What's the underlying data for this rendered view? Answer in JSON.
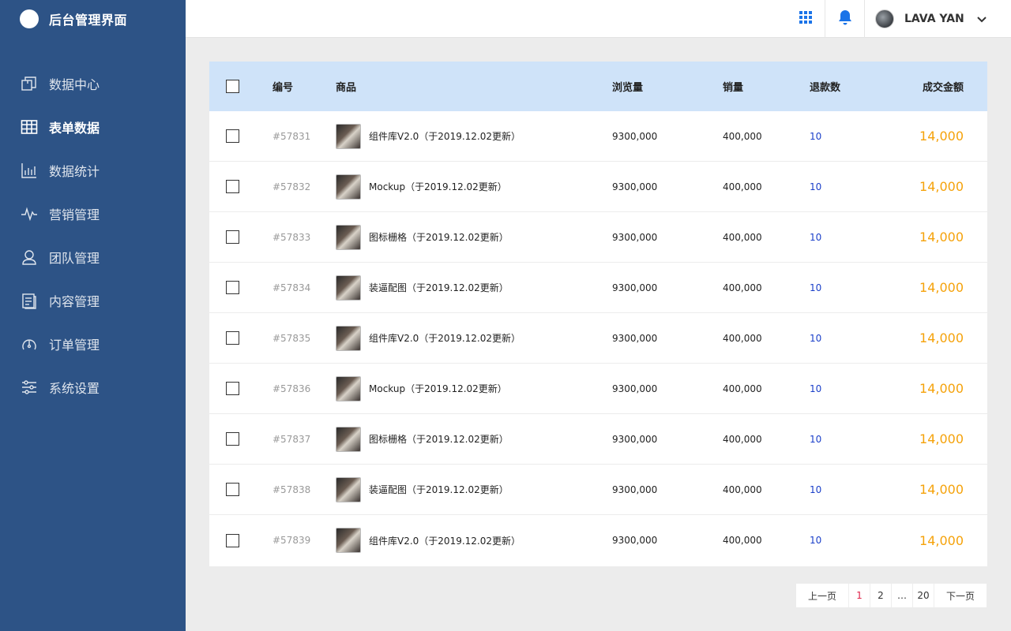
{
  "sidebar": {
    "title": "后台管理界面",
    "items": [
      {
        "label": "数据中心",
        "icon": "copy-icon",
        "active": false
      },
      {
        "label": "表单数据",
        "icon": "table-icon",
        "active": true
      },
      {
        "label": "数据统计",
        "icon": "bar-chart-icon",
        "active": false
      },
      {
        "label": "营销管理",
        "icon": "pulse-icon",
        "active": false
      },
      {
        "label": "团队管理",
        "icon": "user-icon",
        "active": false
      },
      {
        "label": "内容管理",
        "icon": "document-icon",
        "active": false
      },
      {
        "label": "订单管理",
        "icon": "gauge-icon",
        "active": false
      },
      {
        "label": "系统设置",
        "icon": "settings-sliders-icon",
        "active": false
      }
    ]
  },
  "topbar": {
    "user_name": "LAVA YAN",
    "icons": [
      "apps-grid-icon",
      "bell-icon",
      "avatar",
      "chevron-down-icon"
    ],
    "accent_color": "#1a73e8"
  },
  "table": {
    "headers": {
      "id": "编号",
      "product": "商品",
      "views": "浏览量",
      "sales": "销量",
      "refunds": "退款数",
      "amount": "成交金额"
    },
    "header_bg": "#cfe3f9",
    "rows": [
      {
        "id": "#57831",
        "product": "组件库V2.0（于2019.12.02更新）",
        "views": "9300,000",
        "sales": "400,000",
        "refunds": "10",
        "amount": "14,000"
      },
      {
        "id": "#57832",
        "product": "Mockup（于2019.12.02更新）",
        "views": "9300,000",
        "sales": "400,000",
        "refunds": "10",
        "amount": "14,000"
      },
      {
        "id": "#57833",
        "product": "图标栅格（于2019.12.02更新）",
        "views": "9300,000",
        "sales": "400,000",
        "refunds": "10",
        "amount": "14,000"
      },
      {
        "id": "#57834",
        "product": "装逼配图（于2019.12.02更新）",
        "views": "9300,000",
        "sales": "400,000",
        "refunds": "10",
        "amount": "14,000"
      },
      {
        "id": "#57835",
        "product": "组件库V2.0（于2019.12.02更新）",
        "views": "9300,000",
        "sales": "400,000",
        "refunds": "10",
        "amount": "14,000"
      },
      {
        "id": "#57836",
        "product": "Mockup（于2019.12.02更新）",
        "views": "9300,000",
        "sales": "400,000",
        "refunds": "10",
        "amount": "14,000"
      },
      {
        "id": "#57837",
        "product": "图标栅格（于2019.12.02更新）",
        "views": "9300,000",
        "sales": "400,000",
        "refunds": "10",
        "amount": "14,000"
      },
      {
        "id": "#57838",
        "product": "装逼配图（于2019.12.02更新）",
        "views": "9300,000",
        "sales": "400,000",
        "refunds": "10",
        "amount": "14,000"
      },
      {
        "id": "#57839",
        "product": "组件库V2.0（于2019.12.02更新）",
        "views": "9300,000",
        "sales": "400,000",
        "refunds": "10",
        "amount": "14,000"
      }
    ]
  },
  "pagination": {
    "prev": "上一页",
    "pages": [
      "1",
      "2",
      "…",
      "20"
    ],
    "current": "1",
    "next": "下一页"
  }
}
